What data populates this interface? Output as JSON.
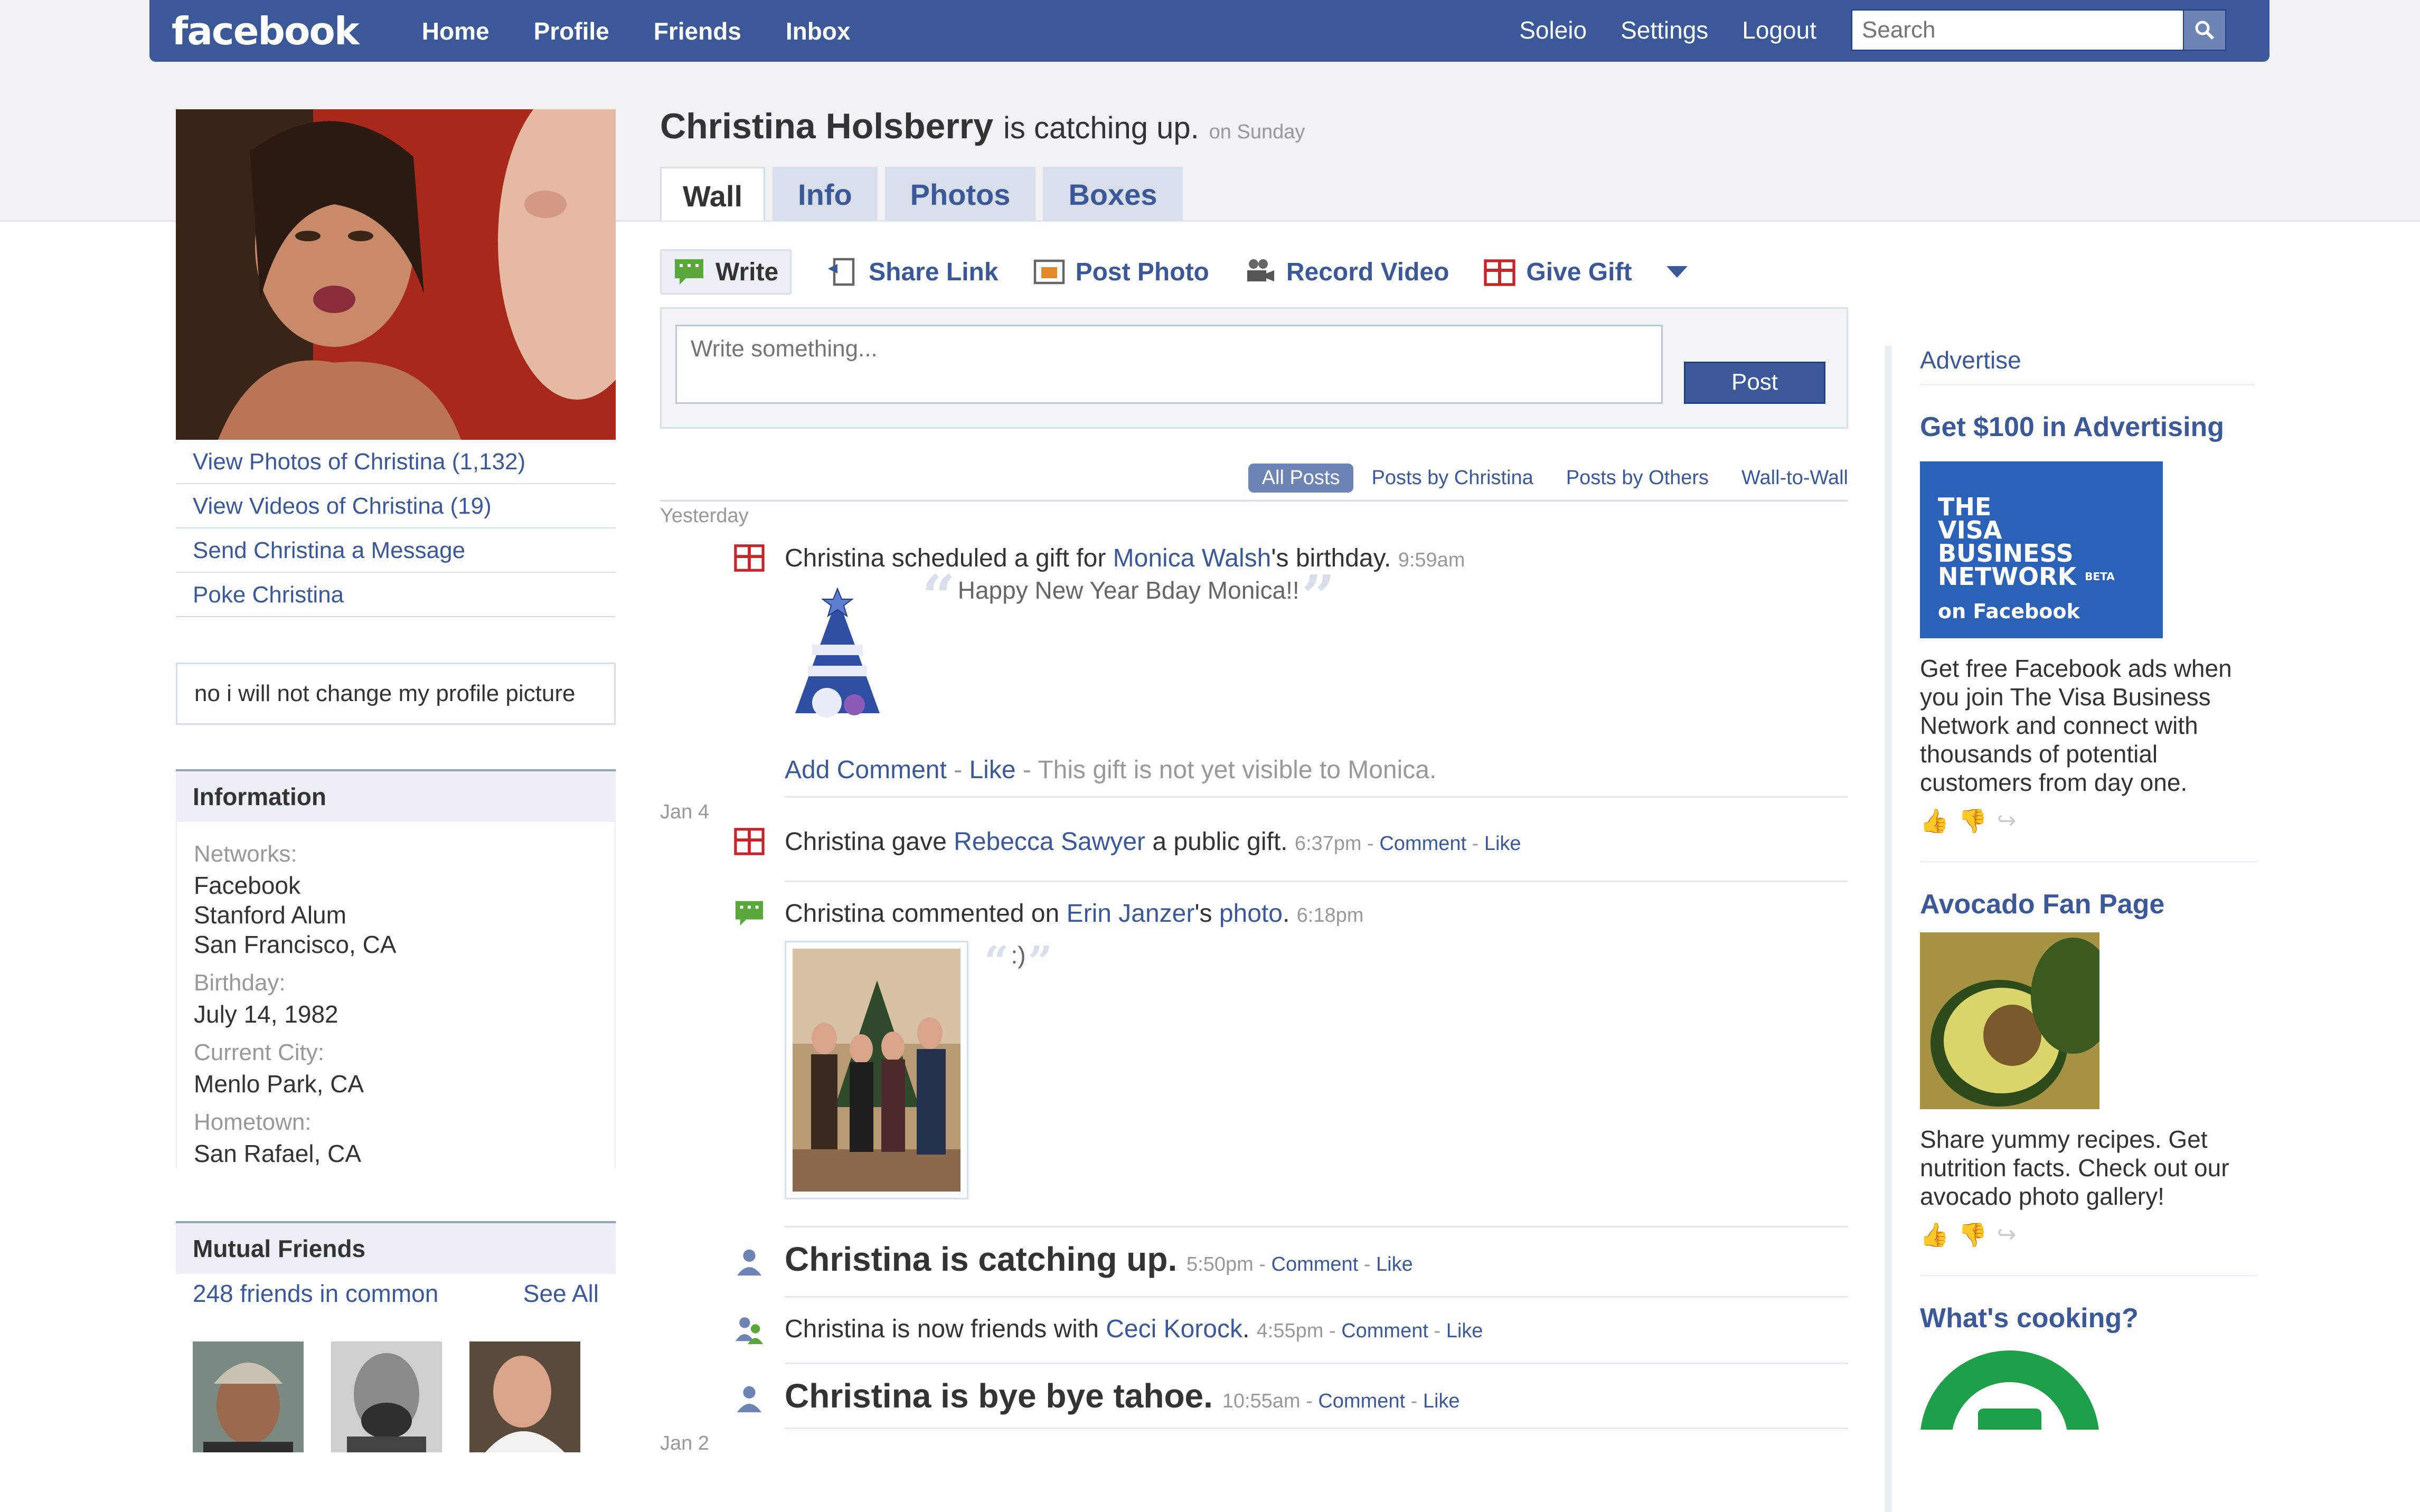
{
  "topbar": {
    "logo": "facebook",
    "nav": [
      "Home",
      "Profile",
      "Friends",
      "Inbox"
    ],
    "right_nav": [
      "Soleio",
      "Settings",
      "Logout"
    ],
    "search_placeholder": "Search"
  },
  "profile": {
    "name": "Christina Holsberry",
    "status": "is catching up.",
    "status_time": "on Sunday",
    "tabs": [
      "Wall",
      "Info",
      "Photos",
      "Boxes"
    ],
    "actions": [
      "View Photos of Christina (1,132)",
      "View Videos of Christina (19)",
      "Send Christina a Message",
      "Poke Christina"
    ],
    "about": "no i will not change my profile picture"
  },
  "information": {
    "heading": "Information",
    "networks_label": "Networks:",
    "networks": [
      "Facebook",
      "Stanford Alum",
      "San Francisco, CA"
    ],
    "birthday_label": "Birthday:",
    "birthday": "July 14, 1982",
    "city_label": "Current City:",
    "city": "Menlo Park, CA",
    "hometown_label": "Hometown:",
    "hometown": "San Rafael, CA"
  },
  "mutual": {
    "heading": "Mutual Friends",
    "count": "248 friends in common",
    "see_all": "See All"
  },
  "publisher": {
    "items": [
      "Write",
      "Share Link",
      "Post Photo",
      "Record Video",
      "Give Gift"
    ],
    "placeholder": "Write something...",
    "post_button": "Post"
  },
  "filters": [
    "All Posts",
    "Posts by Christina",
    "Posts by Others",
    "Wall-to-Wall"
  ],
  "feed": {
    "date1": "Yesterday",
    "s1": {
      "a": "Christina scheduled a gift for ",
      "link": "Monica Walsh",
      "b": "'s birthday.",
      "time": "9:59am"
    },
    "gift_msg": "Happy New Year Bday Monica!!",
    "gift_actions": {
      "comment": "Add Comment",
      "like": "Like",
      "note": "This gift is not yet visible to Monica."
    },
    "date2": "Jan 4",
    "s2": {
      "a": "Christina gave ",
      "link": "Rebecca Sawyer",
      "b": " a public gift.",
      "time": "6:37pm",
      "comment": "Comment",
      "like": "Like"
    },
    "s3": {
      "a": "Christina commented on ",
      "link": "Erin Janzer",
      "b": "'s ",
      "link2": "photo",
      "c": ".",
      "time": "6:18pm",
      "quote": ":)"
    },
    "s4": {
      "text": "Christina is catching up.",
      "time": "5:50pm",
      "comment": "Comment",
      "like": "Like"
    },
    "s5": {
      "a": "Christina is now friends with ",
      "link": "Ceci Korock",
      "b": ".",
      "time": "4:55pm",
      "comment": "Comment",
      "like": "Like"
    },
    "s6": {
      "text": "Christina is bye bye tahoe.",
      "time": "10:55am",
      "comment": "Comment",
      "like": "Like"
    },
    "date3": "Jan 2"
  },
  "ads": {
    "heading": "Advertise",
    "ad1": {
      "title": "Get $100 in Advertising",
      "img_line1": "THE",
      "img_line2": "VISA BUSINESS",
      "img_line3": "NETWORK",
      "img_beta": "BETA",
      "img_line4": "on Facebook",
      "body": "Get free Facebook ads when you join The Visa Business Network and connect with thousands of potential customers from day one."
    },
    "ad2": {
      "title": "Avocado Fan Page",
      "body": "Share yummy recipes. Get nutrition facts. Check out our avocado photo gallery!"
    },
    "ad3": {
      "title": "What's cooking?"
    }
  },
  "colors": {
    "brand": "#3b5998",
    "link": "#3b5998",
    "muted": "#999999"
  }
}
